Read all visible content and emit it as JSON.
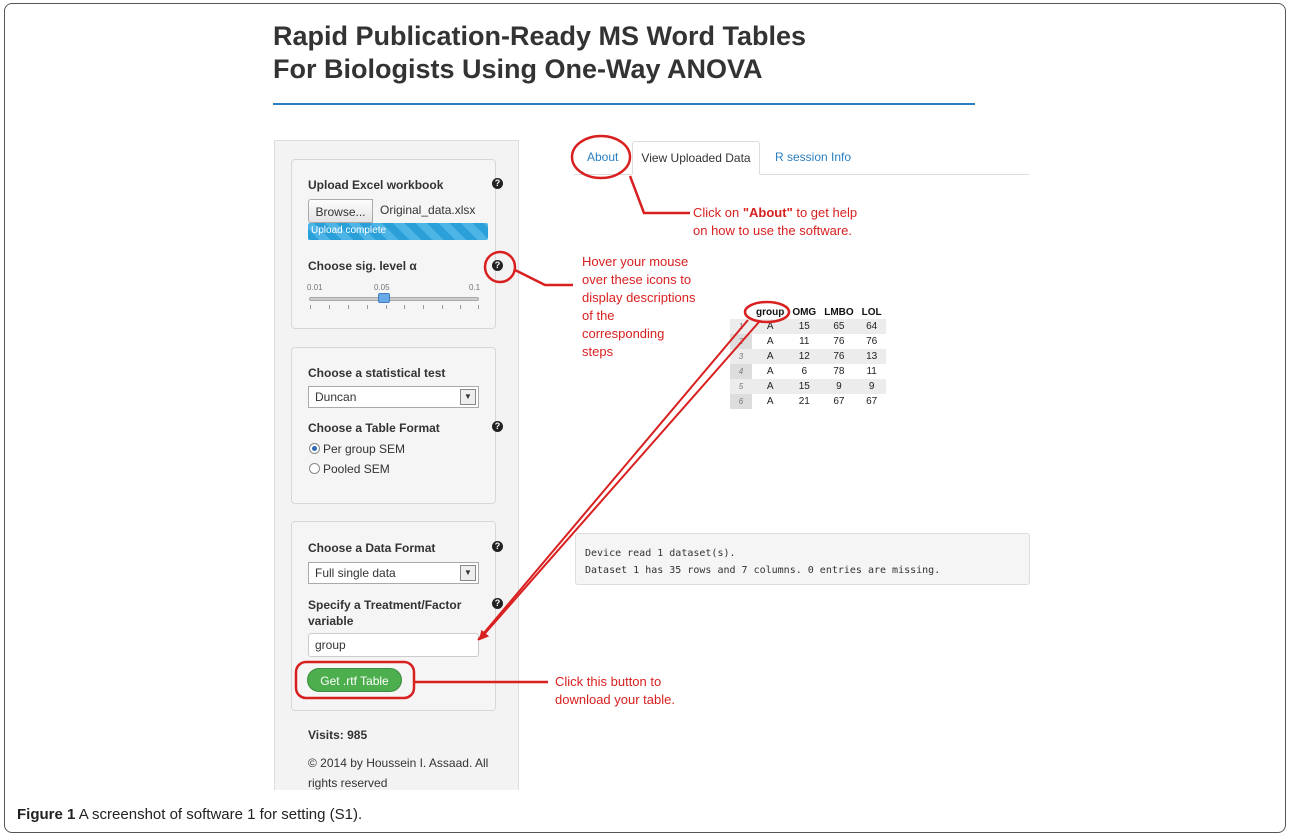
{
  "app": {
    "title_line1": "Rapid Publication-Ready MS Word Tables",
    "title_line2": "For Biologists Using One-Way ANOVA"
  },
  "sidebar": {
    "upload": {
      "label": "Upload Excel workbook",
      "browse_label": "Browse...",
      "file_name": "Original_data.xlsx",
      "progress_text": "Upload complete",
      "progress": 1.0
    },
    "siglevel": {
      "label": "Choose sig. level α",
      "min_label": "0.01",
      "value_label": "0.05",
      "max_label": "0.1",
      "value": 0.05
    },
    "test": {
      "label": "Choose a statistical test",
      "selected": "Duncan"
    },
    "table_format": {
      "label": "Choose a Table Format",
      "options": [
        "Per group SEM",
        "Pooled SEM"
      ],
      "selected_index": 0
    },
    "data_format": {
      "label": "Choose a Data Format",
      "selected": "Full single data"
    },
    "treatment": {
      "label_line1": "Specify a Treatment/Factor",
      "label_line2": "variable",
      "value": "group"
    },
    "get_button": "Get .rtf Table",
    "visits": "Visits: 985",
    "copyright": "© 2014 by Houssein I. Assaad. All rights reserved"
  },
  "tabs": [
    {
      "label": "About",
      "active": false
    },
    {
      "label": "View Uploaded Data",
      "active": true
    },
    {
      "label": "R session Info",
      "active": false
    }
  ],
  "table": {
    "columns": [
      "",
      "group",
      "OMG",
      "LMBO",
      "LOL"
    ],
    "rows": [
      [
        "1",
        "A",
        "15",
        "65",
        "64"
      ],
      [
        "2",
        "A",
        "11",
        "76",
        "76"
      ],
      [
        "3",
        "A",
        "12",
        "76",
        "13"
      ],
      [
        "4",
        "A",
        "6",
        "78",
        "11"
      ],
      [
        "5",
        "A",
        "15",
        "9",
        "9"
      ],
      [
        "6",
        "A",
        "21",
        "67",
        "67"
      ]
    ]
  },
  "console": {
    "line1": "Device read  1 dataset(s).",
    "line2": "Dataset 1 has 35 rows and 7 columns. 0 entries are missing."
  },
  "annotations": {
    "about_pre": "Click on ",
    "about_bold": "\"About\"",
    "about_post": " to get help",
    "about_line2": "on how to use the software.",
    "hover_lines": [
      "Hover your mouse",
      "over these icons to",
      "display descriptions",
      "of the",
      "corresponding",
      "steps"
    ],
    "button_line1": "Click this button to",
    "button_line2": "download your table."
  },
  "caption": {
    "bold": "Figure 1",
    "text": " A screenshot of software 1 for setting (S1)."
  },
  "colors": {
    "accent_blue": "#2e7bbf",
    "annotation_red": "#d92020",
    "button_green": "#4cae4c"
  }
}
